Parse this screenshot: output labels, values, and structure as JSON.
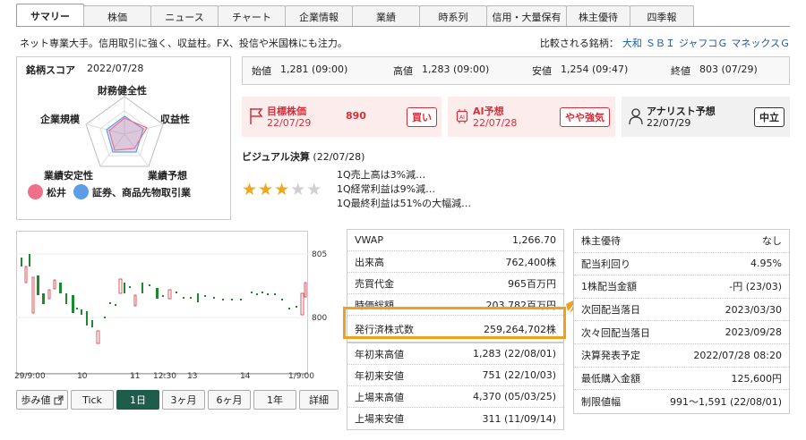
{
  "tabs": [
    "サマリー",
    "株価",
    "ニュース",
    "チャート",
    "企業情報",
    "業績",
    "時系列",
    "信用・大量保有",
    "株主優待",
    "四季報"
  ],
  "description": "ネット専業大手。信用取引に強く、収益柱。FX、投信や米国株にも注力。",
  "compared": {
    "label": "比較される銘柄：",
    "links": [
      "大和",
      "ＳＢＩ",
      "ジャフコＧ",
      "マネックスＧ"
    ]
  },
  "score": {
    "title": "銘柄スコア",
    "date": "2022/07/28",
    "axes": [
      "財務健全性",
      "収益性",
      "業績予想",
      "業績安定性",
      "企業規模"
    ],
    "legend": [
      {
        "name": "松井",
        "color": "#f0708a"
      },
      {
        "name": "証券、商品先物取引業",
        "color": "#5b9de8"
      }
    ]
  },
  "prices": [
    {
      "label": "始値",
      "value": "1,281 (09:00)"
    },
    {
      "label": "高値",
      "value": "1,283 (09:00)"
    },
    {
      "label": "安値",
      "value": "1,254 (09:47)"
    },
    {
      "label": "終値",
      "value": "803 (07/29)"
    }
  ],
  "target": {
    "title": "目標株価",
    "date": "22/07/29",
    "value": "890",
    "badge": "買い"
  },
  "ai": {
    "title": "AI予想",
    "date": "22/07/28",
    "badge": "やや強気"
  },
  "analyst": {
    "title": "アナリスト予想",
    "date": "22/07/29",
    "badge": "中立"
  },
  "visual": {
    "title": "ビジュアル決算",
    "date": "(22/07/28)",
    "stars": 3,
    "lines": [
      "1Q売上高は3%減…",
      "1Q経常利益は9%減…",
      "1Q最終利益は51%の大幅減…"
    ]
  },
  "chart": {
    "y_labels": [
      "805",
      "800"
    ],
    "x_labels": [
      "29/9:00",
      "10",
      "11",
      "12:30",
      "13",
      "14",
      "1/9:00"
    ],
    "buttons": [
      "歩み値",
      "Tick",
      "1日",
      "3ヶ月",
      "6ヶ月",
      "1年",
      "詳細"
    ]
  },
  "market_table": [
    {
      "label": "VWAP",
      "value": "1,266.70"
    },
    {
      "label": "出来高",
      "value": "762,400株"
    },
    {
      "label": "売買代金",
      "value": "965百万円"
    },
    {
      "label": "時価総額",
      "value": "203,782百万円"
    },
    {
      "label": "発行済株式数",
      "value": "259,264,702株"
    }
  ],
  "range_table": [
    {
      "label": "年初来高値",
      "value": "1,283 (22/08/01)"
    },
    {
      "label": "年初来安値",
      "value": "751 (22/10/03)"
    },
    {
      "label": "上場来高値",
      "value": "4,370 (05/03/25)"
    },
    {
      "label": "上場来安値",
      "value": "311 (11/09/14)"
    }
  ],
  "dividend_table": [
    {
      "label": "株主優待",
      "value": "なし"
    },
    {
      "label": "配当利回り",
      "value": "4.95%"
    },
    {
      "label": "1株配当金額",
      "value": "-円 (23/03)"
    },
    {
      "label": "次回配当落日",
      "value": "2023/03/30"
    },
    {
      "label": "次々回配当落日",
      "value": "2023/09/28"
    },
    {
      "label": "決算発表予定",
      "value": "2022/07/28 08:20"
    },
    {
      "label": "最低購入金額",
      "value": "125,600円"
    },
    {
      "label": "制限値幅",
      "value": "991～1,591 (22/08/01)"
    }
  ]
}
